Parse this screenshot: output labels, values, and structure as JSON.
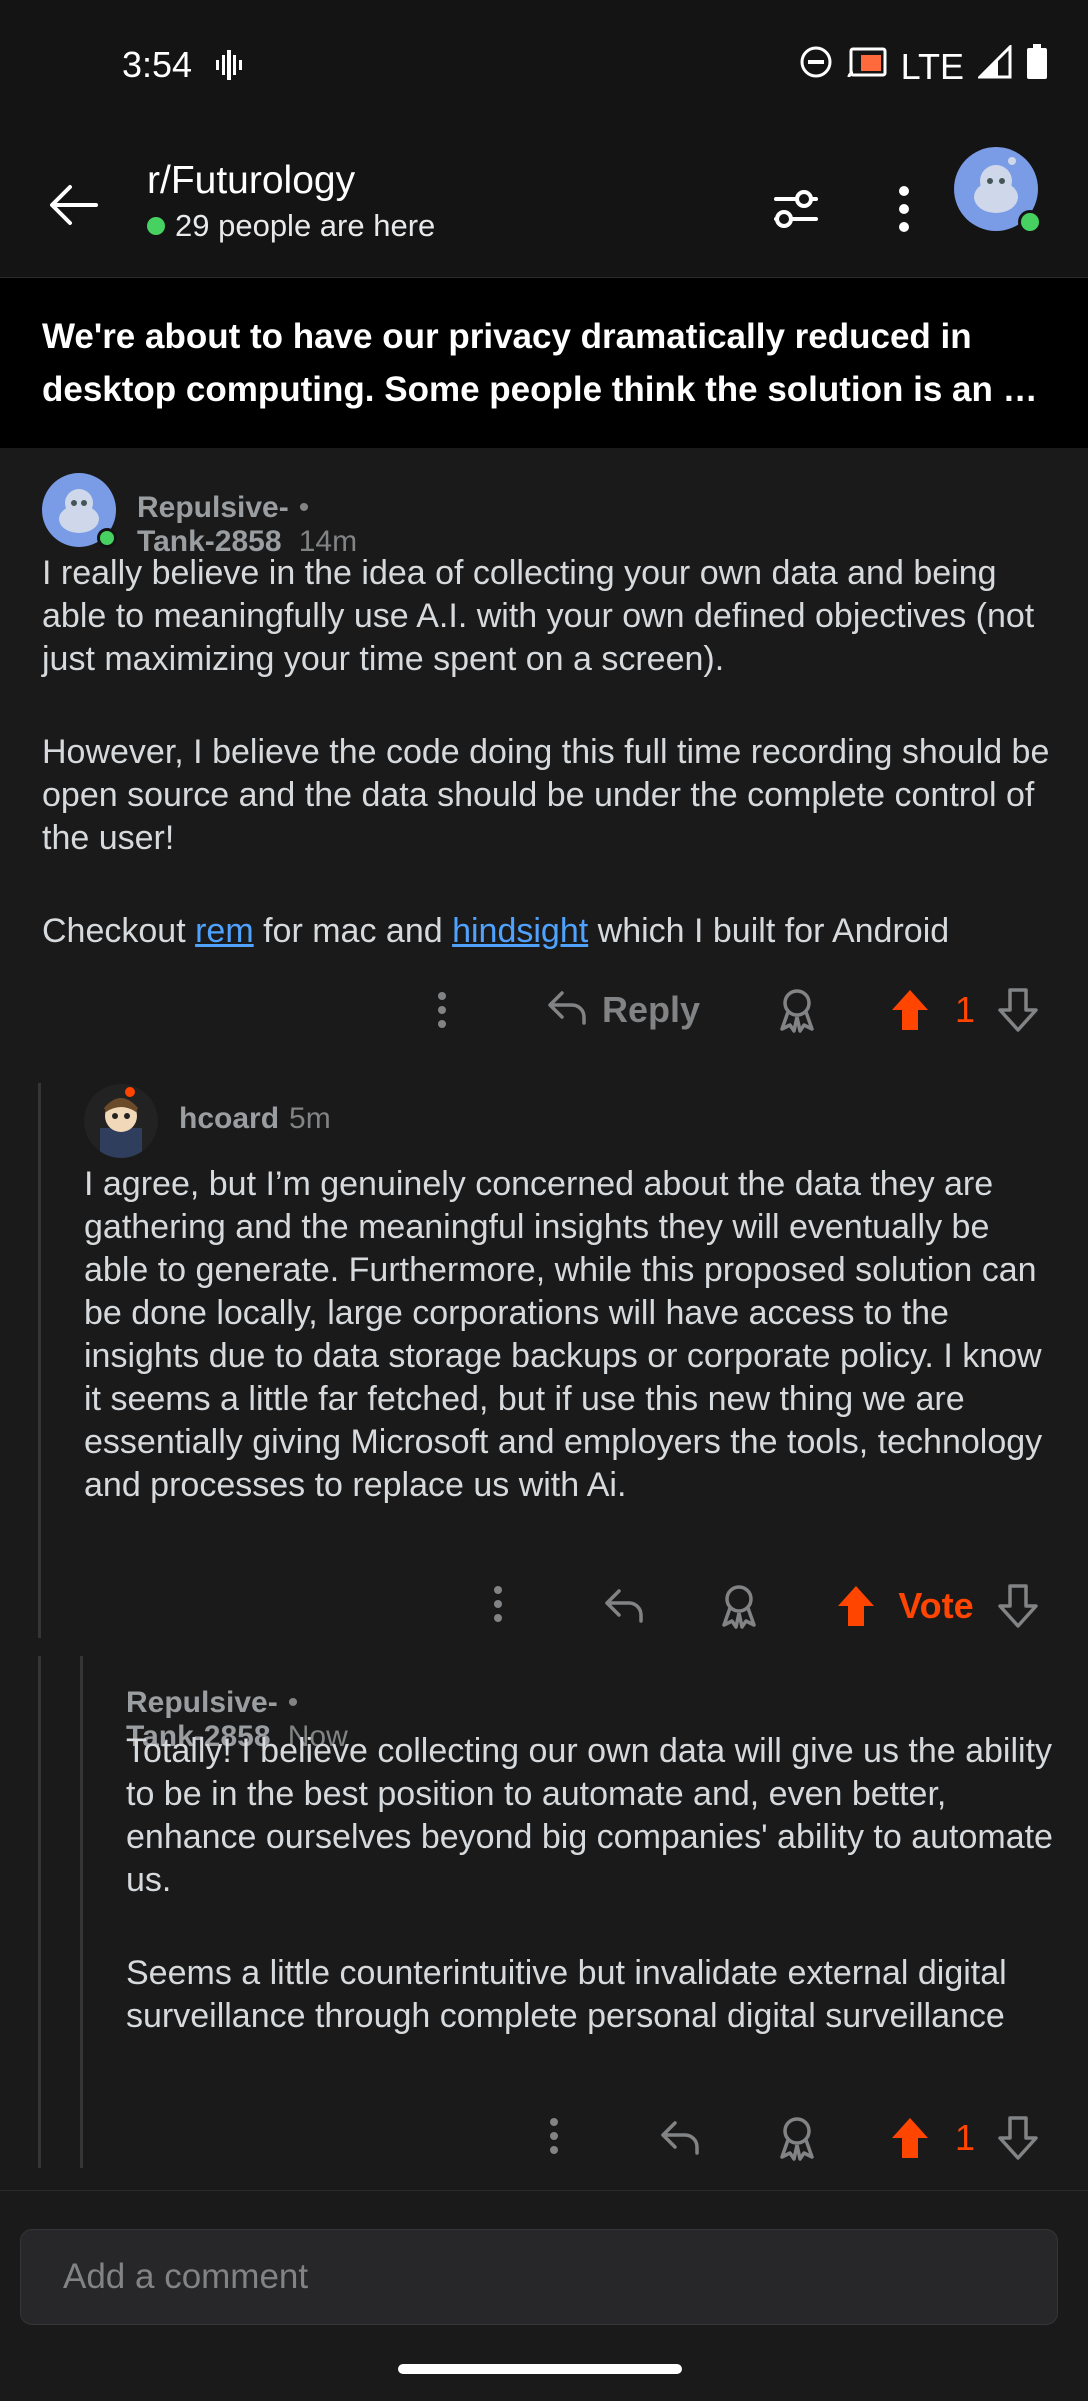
{
  "status_bar": {
    "time": "3:54",
    "network": "LTE"
  },
  "header": {
    "subreddit": "r/Futurology",
    "presence": "29 people are here"
  },
  "post": {
    "title_line1": "We're about to have our privacy dramatically reduced in",
    "title_line2": "desktop computing. Some people think the solution is an op…"
  },
  "comments": [
    {
      "author": "Repulsive-Tank-2858",
      "meta": "• 14m",
      "para1": "I really believe in the idea of collecting your own data and being able to meaningfully use A.I. with your own defined objectives (not just maximizing your time spent on a screen).",
      "para2": "However, I believe the code doing this full time recording should be open source and the data should be under the complete control of the user!",
      "para3_prefix": "Checkout ",
      "link1": "rem",
      "para3_mid": " for mac and ",
      "link2": "hindsight",
      "para3_suffix": " which I built for Android",
      "reply_label": "Reply",
      "votes": "1"
    },
    {
      "author": "hcoard",
      "meta": "5m",
      "body": "I agree, but I’m genuinely concerned about the data they are gathering and the meaningful insights they will eventually be able to generate. Furthermore, while this proposed solution can be done locally, large corporations will have access to the insights due to data storage backups or corporate policy. I know it seems a little far fetched, but if use this new thing we are essentially giving Microsoft and employers the tools, technology and processes to replace us with Ai.",
      "vote_label": "Vote"
    },
    {
      "author": "Repulsive-Tank-2858",
      "meta": "• Now",
      "para1": "Totally! I believe collecting our own data will give us the ability to be in the best position to automate and, even better, enhance ourselves beyond big companies' ability to automate us.",
      "para2": "Seems a little counterintuitive but invalidate external digital surveillance through complete personal digital surveillance",
      "votes": "1"
    }
  ],
  "composer": {
    "placeholder": "Add a comment"
  },
  "colors": {
    "upvote": "#ff4500",
    "link": "#4fa3ff",
    "online": "#46d160",
    "background": "#1a1a1b"
  }
}
